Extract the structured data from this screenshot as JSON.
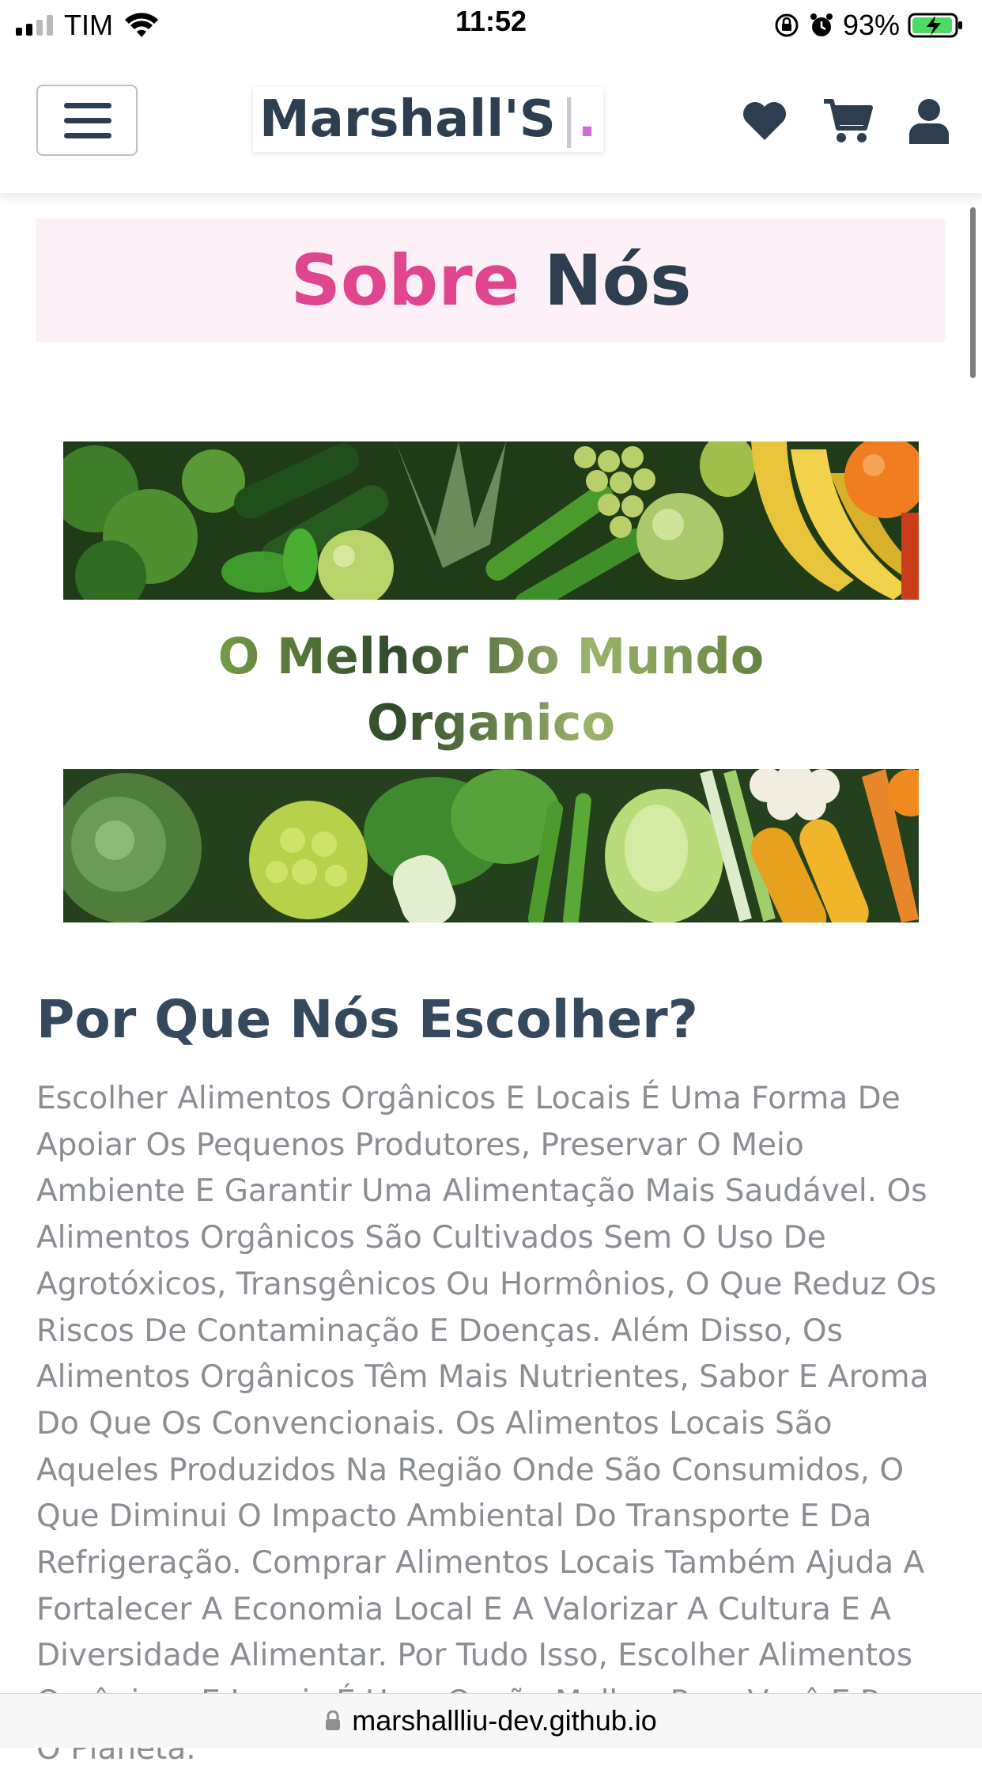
{
  "status_bar": {
    "carrier": "TIM",
    "time": "11:52",
    "battery": "93%",
    "icons": [
      "signal-icon",
      "wifi-icon",
      "orientation-lock-icon",
      "alarm-icon",
      "battery-charging-icon"
    ]
  },
  "header": {
    "logo_text": "Marshall'S",
    "logo_cursor": "|",
    "logo_dot": ".",
    "icons": [
      "menu-icon",
      "heart-icon",
      "cart-icon",
      "user-icon"
    ]
  },
  "about": {
    "title_accent": "Sobre",
    "title_rest": "Nós",
    "tagline_line1": "O Melhor Do Mundo",
    "tagline_line2": "Organico",
    "section_title": "Por Que Nós Escolher?",
    "paragraph": "Escolher Alimentos Orgânicos E Locais É Uma Forma De Apoiar Os Pequenos Produtores, Preservar O Meio Ambiente E Garantir Uma Alimentação Mais Saudável. Os Alimentos Orgânicos São Cultivados Sem O Uso De Agrotóxicos, Transgênicos Ou Hormônios, O Que Reduz Os Riscos De Contaminação E Doenças. Além Disso, Os Alimentos Orgânicos Têm Mais Nutrientes, Sabor E Aroma Do Que Os Convencionais. Os Alimentos Locais São Aqueles Produzidos Na Região Onde São Consumidos, O Que Diminui O Impacto Ambiental Do Transporte E Da Refrigeração. Comprar Alimentos Locais Também Ajuda A Fortalecer A Economia Local E A Valorizar A Cultura E A Diversidade Alimentar. Por Tudo Isso, Escolher Alimentos Orgânicos E Locais É Uma Opção Melhor Para Você E Para O Planeta."
  },
  "url_bar": {
    "url": "marshallliu-dev.github.io"
  },
  "colors": {
    "accent_pink": "#e0468d",
    "title_bg": "#fdf0f6",
    "heading": "#2c3e50",
    "body_text": "#8a8e93"
  }
}
